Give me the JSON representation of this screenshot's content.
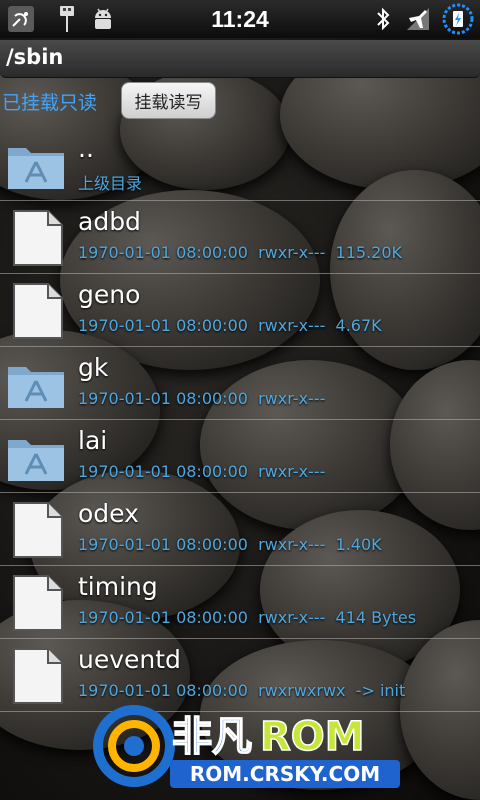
{
  "status_bar": {
    "time": "11:24",
    "left_icons": [
      "satellite-icon",
      "usb-icon",
      "android-debug-icon"
    ],
    "right_icons": [
      "bluetooth-icon",
      "airplane-signal-icon",
      "battery-charging-icon"
    ]
  },
  "path_bar": {
    "path": "/sbin"
  },
  "mount": {
    "status": "已挂载只读",
    "button_label": "挂载读写"
  },
  "files": [
    {
      "name": "..",
      "meta": "上级目录",
      "type": "folder"
    },
    {
      "name": "adbd",
      "meta": "1970-01-01 08:00:00  rwxr-x---  115.20K",
      "type": "file"
    },
    {
      "name": "geno",
      "meta": "1970-01-01 08:00:00  rwxr-x---  4.67K",
      "type": "file"
    },
    {
      "name": "gk",
      "meta": "1970-01-01 08:00:00  rwxr-x---",
      "type": "folder"
    },
    {
      "name": "lai",
      "meta": "1970-01-01 08:00:00  rwxr-x---",
      "type": "folder"
    },
    {
      "name": "odex",
      "meta": "1970-01-01 08:00:00  rwxr-x---  1.40K",
      "type": "file"
    },
    {
      "name": "timing",
      "meta": "1970-01-01 08:00:00  rwxr-x---  414 Bytes",
      "type": "file"
    },
    {
      "name": "ueventd",
      "meta": "1970-01-01 08:00:00  rwxrwxrwx  -> init",
      "type": "file"
    }
  ],
  "watermark": {
    "brand_cn": "非凡",
    "brand_en": "ROM",
    "url": "ROM.CRSKY.COM"
  },
  "colors": {
    "meta_text": "#4ea8e0",
    "mount_status": "#3da5ff",
    "folder": "#8db7d8"
  }
}
